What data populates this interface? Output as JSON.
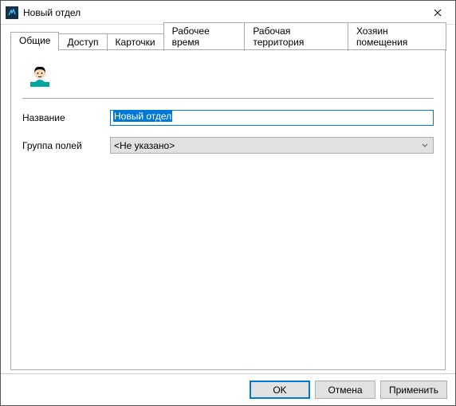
{
  "window": {
    "title": "Новый отдел"
  },
  "tabs": [
    {
      "label": "Общие"
    },
    {
      "label": "Доступ"
    },
    {
      "label": "Карточки"
    },
    {
      "label": "Рабочее время"
    },
    {
      "label": "Рабочая территория"
    },
    {
      "label": "Хозяин помещения"
    }
  ],
  "form": {
    "name_label": "Название",
    "name_value": "Новый отдел",
    "group_label": "Группа полей",
    "group_value": "<Не указано>"
  },
  "buttons": {
    "ok": "OK",
    "cancel": "Отмена",
    "apply": "Применить"
  }
}
